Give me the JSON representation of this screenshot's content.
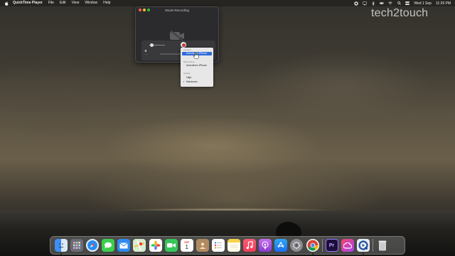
{
  "menubar": {
    "app_name": "QuickTime Player",
    "items": [
      "File",
      "Edit",
      "View",
      "Window",
      "Help"
    ],
    "date": "Wed 1 Sep",
    "time": "11:26 PM"
  },
  "watermark": "tech2touch",
  "window": {
    "title": "Movie Recording",
    "timecode": "--:--"
  },
  "options_menu": {
    "camera_header": "Camera",
    "camera_option": "Anirudha's iPhone",
    "microphone_header": "Microphone",
    "microphone_option": "Anirudha's iPhone",
    "quality_header": "Quality",
    "quality_options": [
      "High",
      "Maximum"
    ],
    "quality_selected": "Maximum",
    "check_mark": "✓"
  },
  "dock": {
    "apps": [
      "Finder",
      "Launchpad",
      "Safari",
      "Messages",
      "Mail",
      "Maps",
      "Photos",
      "FaceTime",
      "Calendar",
      "Contacts",
      "Reminders",
      "Notes",
      "Music",
      "Podcasts",
      "App Store",
      "System Preferences",
      "Chrome",
      "Adobe Premiere Pro",
      "Creative Cloud",
      "QuickTime Player",
      "Trash"
    ],
    "calendar_month": "SEP",
    "calendar_day": "1",
    "premiere_label": "Pr"
  },
  "colors": {
    "selection_blue": "#2f6bd8",
    "record_red": "#c83b3b"
  }
}
